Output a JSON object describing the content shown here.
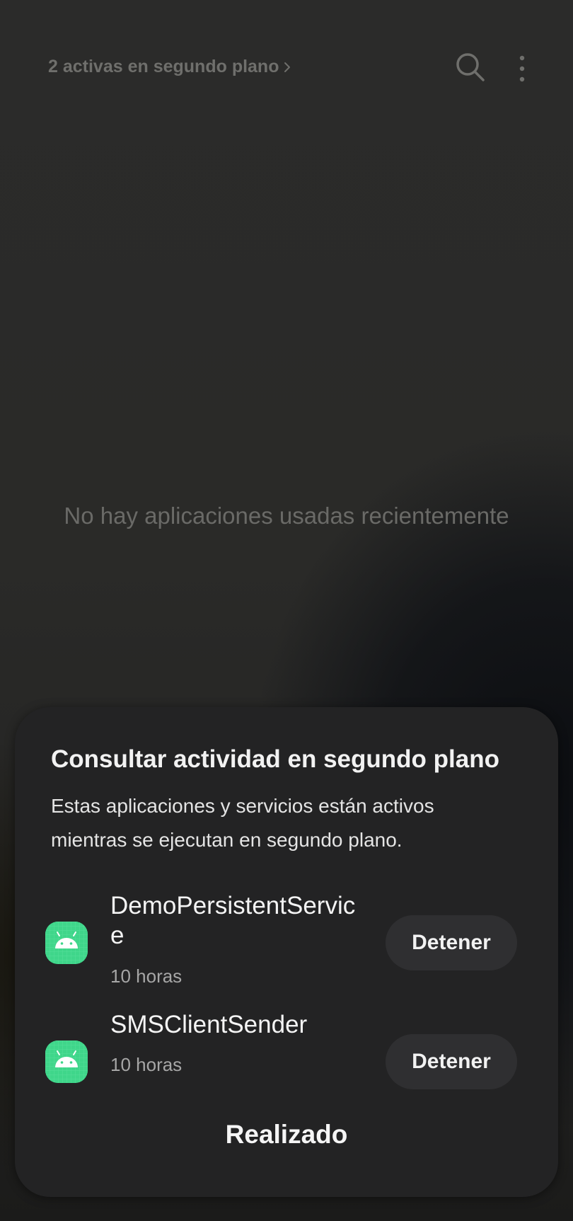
{
  "header": {
    "background_activity_link": "2 activas en segundo plano",
    "search_icon": "search-icon",
    "more_icon": "more-vertical-icon"
  },
  "recents": {
    "empty_message": "No hay aplicaciones usadas recientemente"
  },
  "sheet": {
    "title": "Consultar actividad en segundo plano",
    "description": "Estas aplicaciones y servicios están activos mientras se ejecutan en segundo plano.",
    "apps": [
      {
        "name": "DemoPersistentService",
        "time": "10 horas",
        "button": "Detener",
        "icon": "android-icon"
      },
      {
        "name": "SMSClientSender",
        "time": "10 horas",
        "button": "Detener",
        "icon": "android-icon"
      }
    ],
    "done_label": "Realizado"
  },
  "colors": {
    "icon_green": "#3fd68a",
    "sheet_bg": "#232324"
  }
}
